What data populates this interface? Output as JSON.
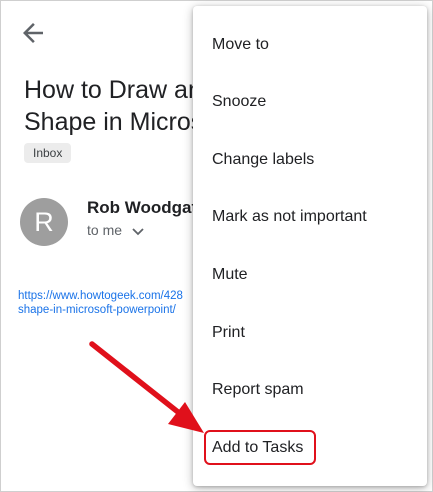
{
  "email": {
    "subject_line1": "How to Draw and",
    "subject_line2": "Shape in Microso",
    "label": "Inbox",
    "avatar_initial": "R",
    "sender": "Rob Woodgate",
    "recipient": "to me",
    "link_line1": "https://www.howtogeek.com/428",
    "link_line2": "shape-in-microsoft-powerpoint/"
  },
  "menu": {
    "items": [
      {
        "label": "Move to"
      },
      {
        "label": "Snooze"
      },
      {
        "label": "Change labels"
      },
      {
        "label": "Mark as not important"
      },
      {
        "label": "Mute"
      },
      {
        "label": "Print"
      },
      {
        "label": "Report spam"
      },
      {
        "label": "Add to Tasks"
      }
    ]
  },
  "icons": {
    "back": "arrow-left-icon",
    "recipient_details": "chevron-down-icon"
  },
  "colors": {
    "highlight": "#e0101b",
    "link": "#1a73e8",
    "avatar": "#9e9e9e"
  }
}
